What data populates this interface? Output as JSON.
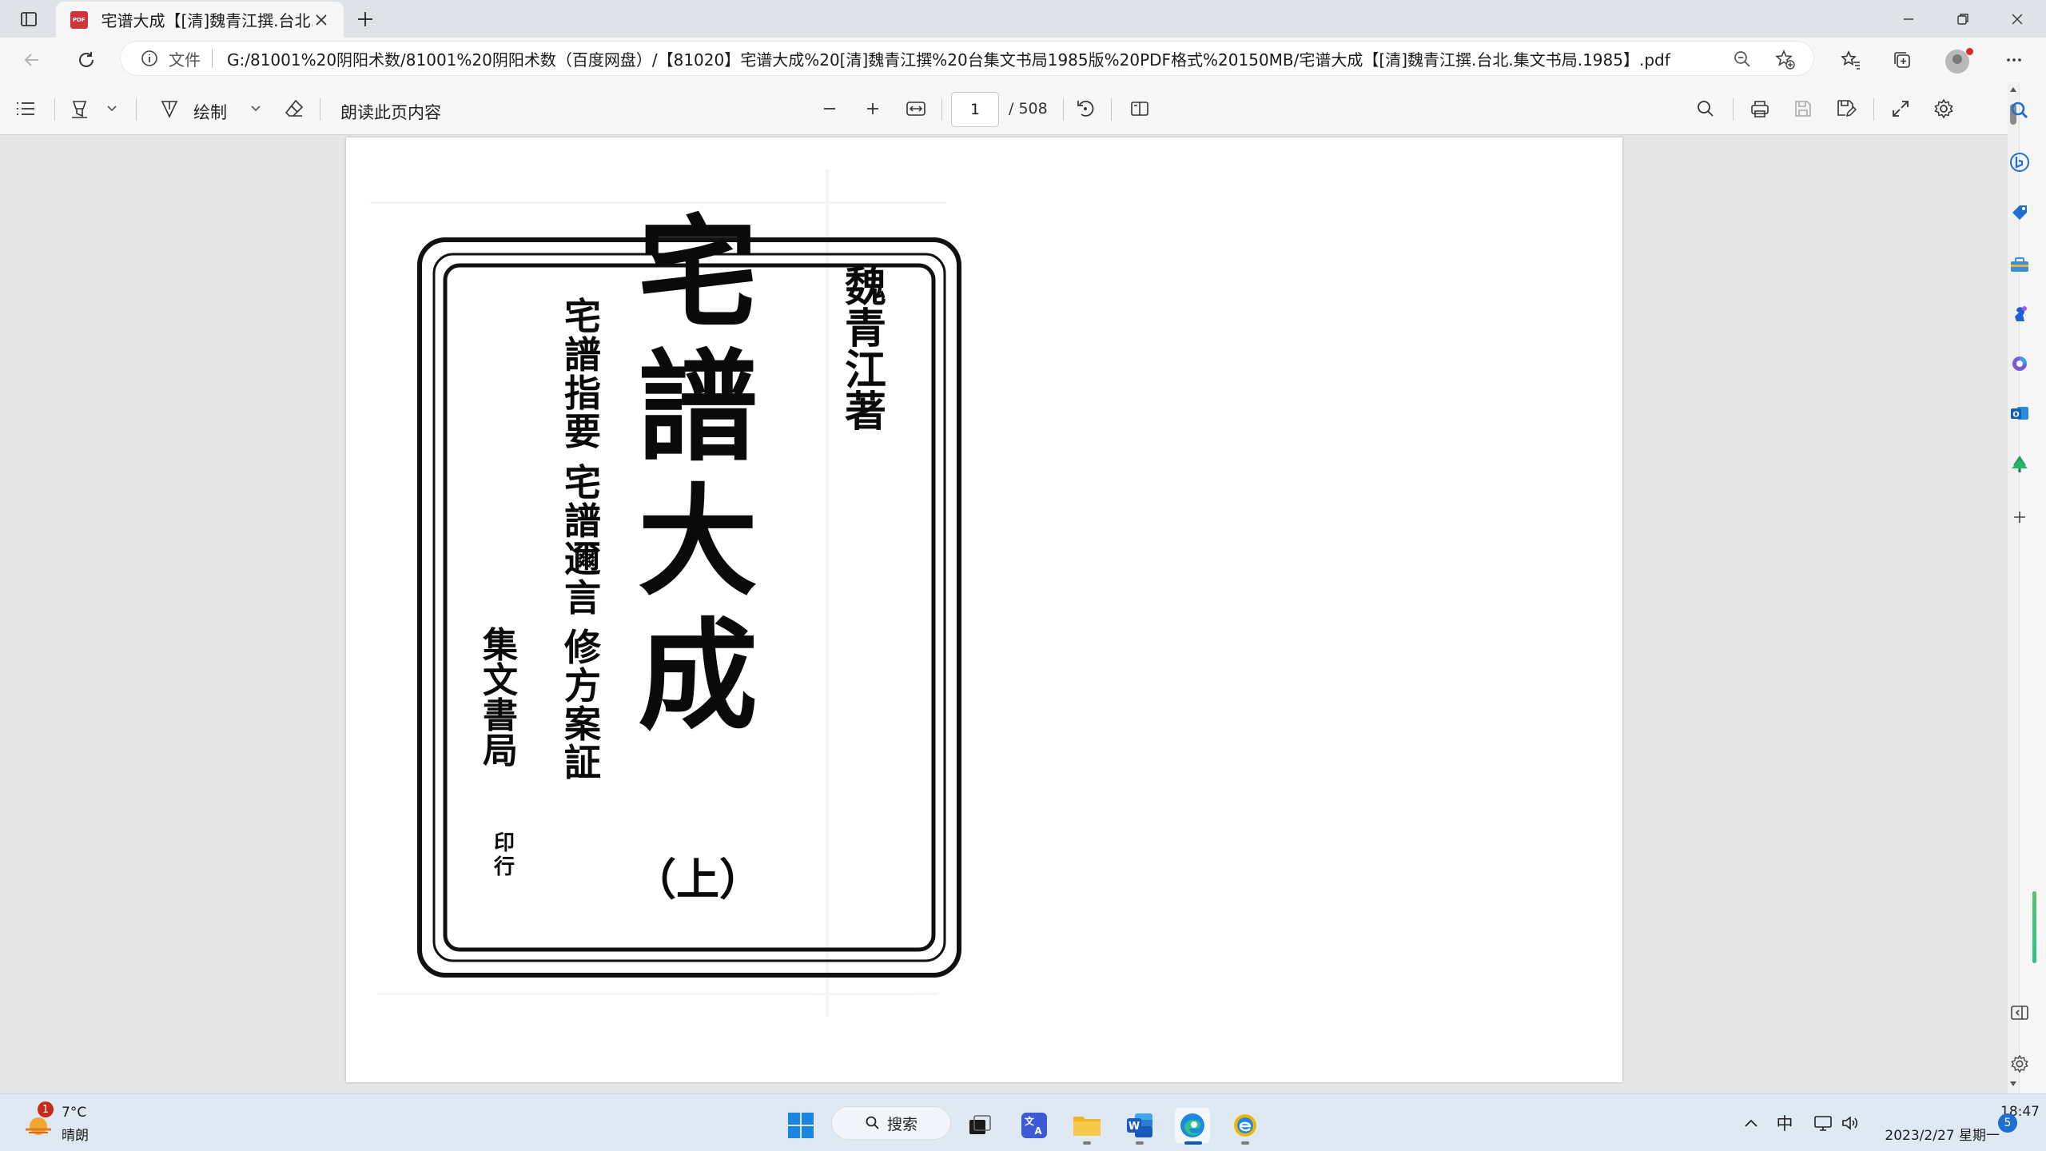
{
  "browser": {
    "tab_title": "宅谱大成【[清]魏青江撰.台北.集文书局.1985】.pdf",
    "tab_icon": "PDF",
    "address_label": "文件",
    "url": "G:/81001%20阴阳术数/81001%20阴阳术数（百度网盘）/【81020】宅谱大成%20[清]魏青江撰%20台集文书局1985版%20PDF格式%20150MB/宅谱大成【[清]魏青江撰.台北.集文书局.1985】.pdf"
  },
  "pdf_toolbar": {
    "draw_label": "绘制",
    "read_aloud_label": "朗读此页内容",
    "current_page": "1",
    "page_total": "/ 508"
  },
  "document": {
    "title": "宅譜大成",
    "author": "魏青江著",
    "contents": [
      "宅譜指要",
      "宅譜邇言",
      "修方案証"
    ],
    "publisher": "集文書局",
    "print_note": "印行",
    "volume": "（上）"
  },
  "taskbar": {
    "weather_badge": "1",
    "temperature": "7°C",
    "weather": "晴朗",
    "search_label": "搜索",
    "ime": "中",
    "time": "18:47",
    "date": "2023/2/27 星期一",
    "notifications": "5"
  },
  "colors": {
    "accent": "#0b5cad",
    "pdf_red": "#d13438",
    "edge_blue": "#1e88e5"
  }
}
